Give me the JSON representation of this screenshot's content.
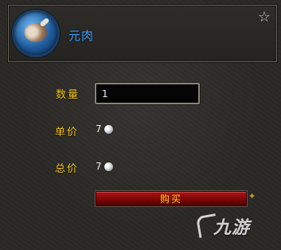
{
  "item": {
    "name": "元肉",
    "icon": "meat-icon"
  },
  "favorite": {
    "icon": "star-outline-icon"
  },
  "quantity": {
    "label": "数量",
    "value": "1"
  },
  "unit_price": {
    "label": "单价",
    "amount": "7",
    "currency_icon": "silver-coin-icon"
  },
  "total_price": {
    "label": "总价",
    "amount": "7",
    "currency_icon": "silver-coin-icon"
  },
  "buy_button": {
    "label": "购买"
  },
  "watermark": {
    "text": "九游"
  },
  "colors": {
    "item_name": "#3ea0ff",
    "label_gold": "#f2c21b",
    "buy_button": "#b01010",
    "buy_text": "#ffd200"
  }
}
